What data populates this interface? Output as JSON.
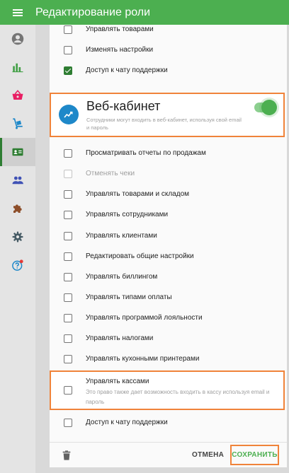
{
  "header": {
    "title": "Редактирование роли",
    "menu_icon": "menu-icon"
  },
  "sidebar": {
    "items": [
      {
        "icon": "account-circle-icon",
        "active": false
      },
      {
        "icon": "bar-chart-icon",
        "active": false
      },
      {
        "icon": "basket-icon",
        "active": false
      },
      {
        "icon": "dolly-icon",
        "active": false
      },
      {
        "icon": "id-card-icon",
        "active": true
      },
      {
        "icon": "people-icon",
        "active": false
      },
      {
        "icon": "puzzle-icon",
        "active": false
      },
      {
        "icon": "gear-icon",
        "active": false
      },
      {
        "icon": "help-icon",
        "active": false,
        "badge": true
      }
    ]
  },
  "pos_permissions": [
    {
      "label": "Управлять товарами",
      "checked": false,
      "disabled": false
    },
    {
      "label": "Изменять настройки",
      "checked": false,
      "disabled": false
    },
    {
      "label": "Доступ к чату поддержки",
      "checked": true,
      "disabled": false
    }
  ],
  "web_cabinet": {
    "title": "Веб-кабинет",
    "description": "Сотрудники могут входить в веб-кабинет, используя свой email и пароль",
    "enabled": true
  },
  "web_permissions": [
    {
      "label": "Просматривать отчеты по продажам",
      "checked": false,
      "disabled": false
    },
    {
      "label": "Отменять чеки",
      "checked": false,
      "disabled": true
    },
    {
      "label": "Управлять товарами и складом",
      "checked": false,
      "disabled": false
    },
    {
      "label": "Управлять сотрудниками",
      "checked": false,
      "disabled": false
    },
    {
      "label": "Управлять клиентами",
      "checked": false,
      "disabled": false
    },
    {
      "label": "Редактировать общие настройки",
      "checked": false,
      "disabled": false
    },
    {
      "label": "Управлять биллингом",
      "checked": false,
      "disabled": false
    },
    {
      "label": "Управлять типами оплаты",
      "checked": false,
      "disabled": false
    },
    {
      "label": "Управлять программой лояльности",
      "checked": false,
      "disabled": false
    },
    {
      "label": "Управлять налогами",
      "checked": false,
      "disabled": false
    },
    {
      "label": "Управлять кухонными принтерами",
      "checked": false,
      "disabled": false
    }
  ],
  "kassa": {
    "label": "Управлять кассами",
    "description": "Это право также дает возможность входить в кассу используя email и пароль",
    "checked": false
  },
  "support_web": {
    "label": "Доступ к чату поддержки",
    "checked": false
  },
  "footer": {
    "cancel_label": "ОТМЕНА",
    "save_label": "СОХРАНИТЬ",
    "delete_icon": "trash-icon"
  },
  "colors": {
    "primary": "#4caf50",
    "highlight": "#f0833a",
    "accent_blue": "#1e88c9",
    "badge_red": "#e53935"
  }
}
